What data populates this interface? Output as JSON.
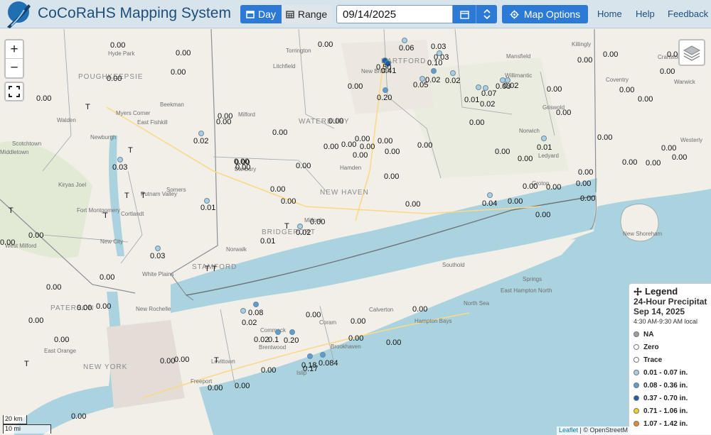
{
  "header": {
    "title": "CoCoRaHS Mapping System",
    "logo_text": "CoCoRaHS",
    "day_label": "Day",
    "range_label": "Range",
    "date_value": "09/14/2025",
    "map_options_label": "Map Options",
    "nav": [
      "Home",
      "Help",
      "Feedback"
    ],
    "accent_color": "#2d7ad6"
  },
  "map": {
    "zoom_in": "+",
    "zoom_out": "−",
    "places": [
      "Torrington",
      "Litchfield",
      "HARTFORD",
      "New Britain",
      "Mansfield",
      "Willimantic",
      "Killingly",
      "Cranston",
      "Coventry",
      "WATERBURY",
      "Milford",
      "Norwich",
      "Griswold",
      "Ledyard",
      "Hamden",
      "Danbury",
      "NEW HAVEN",
      "Milford",
      "BRIDGEPORT",
      "Groton",
      "Norwalk",
      "STAMFORD",
      "Somers",
      "Cortlandt",
      "New City",
      "White Plains",
      "New Rochelle",
      "POUGHKEEPSIE",
      "Hyde Park",
      "Myers Corner",
      "East Fishkill",
      "Beekman",
      "Walden",
      "Newburgh",
      "Middletown",
      "Scotchtown",
      "Kiryas Joel",
      "Fort Montgomery",
      "Putnam Valley",
      "Southold",
      "Springs",
      "East Hampton North",
      "North Sea",
      "Hampton Bays",
      "Calverton",
      "Coram",
      "Brookhaven",
      "Commack",
      "Brentwood",
      "Levittown",
      "Freeport",
      "PATERSON",
      "East Orange",
      "NEW YORK",
      "New Shoreham",
      "West Milford",
      "Westerly",
      "Warwick",
      "Islip"
    ],
    "observations": [
      "0.50",
      "0.41",
      "0.20",
      "0.06",
      "0.05",
      "0.03",
      "0.10",
      "0.02",
      "0.05",
      "0.07",
      "0.03",
      "0.02",
      "0.01",
      "0.02",
      "0.01",
      "0.04",
      "0.02",
      "0.02",
      "0.03",
      "0.08",
      "0.02",
      "0.02",
      "0.1",
      "0.20",
      "0.18",
      "0.17",
      "0.084",
      "0.00",
      "T"
    ],
    "legend": {
      "title": "Legend",
      "heading": "24-Hour Precipitat",
      "date": "Sep 14, 2025",
      "time": "4:30 AM-9:30 AM local",
      "items": [
        {
          "label": "NA",
          "color": "#9e9e9e"
        },
        {
          "label": "Zero",
          "color": "#ffffff"
        },
        {
          "label": "Trace",
          "color": "#ffffff"
        },
        {
          "label": "0.01 - 0.07 in.",
          "color": "#a9cfe0"
        },
        {
          "label": "0.08 - 0.36 in.",
          "color": "#5b9fd0"
        },
        {
          "label": "0.37 - 0.70 in.",
          "color": "#1f5fa8"
        },
        {
          "label": "0.71 - 1.06 in.",
          "color": "#f4d11a"
        },
        {
          "label": "1.07 - 1.42 in.",
          "color": "#e58a2a"
        }
      ]
    },
    "scale_km": "20 km",
    "scale_mi": "10 mi",
    "attribution_leaflet": "Leaflet",
    "attribution_rest": "| © OpenStreetM"
  }
}
